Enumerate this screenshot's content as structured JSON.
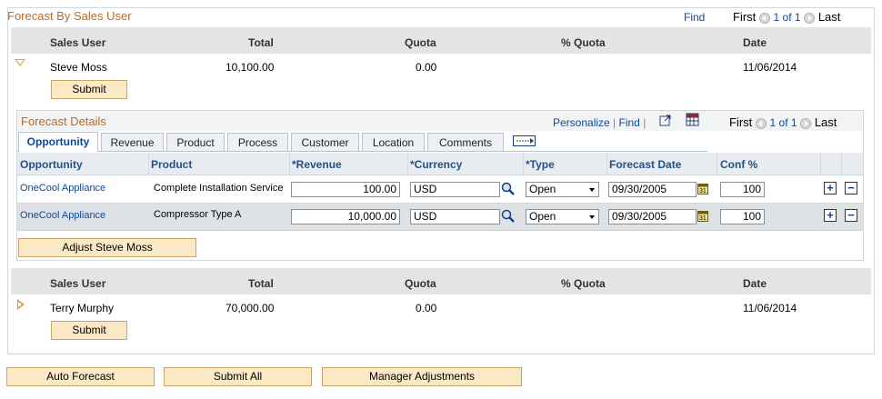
{
  "section": {
    "title": "Forecast By Sales User",
    "find": "Find",
    "first": "First",
    "count": "1 of 1",
    "last": "Last"
  },
  "user_grid": {
    "headers": [
      "Sales User",
      "Total",
      "Quota",
      "% Quota",
      "Date"
    ],
    "users": [
      {
        "name": "Steve Moss",
        "total": "10,100.00",
        "quota": "0.00",
        "pct_quota": "",
        "date": "11/06/2014",
        "submit": "Submit",
        "expanded": true
      },
      {
        "name": "Terry Murphy",
        "total": "70,000.00",
        "quota": "0.00",
        "pct_quota": "",
        "date": "11/06/2014",
        "submit": "Submit",
        "expanded": false
      }
    ]
  },
  "details": {
    "title": "Forecast Details",
    "personalize": "Personalize",
    "find": "Find",
    "first": "First",
    "count": "1 of 1",
    "last": "Last",
    "tabs": [
      "Opportunity",
      "Revenue",
      "Product",
      "Process",
      "Customer",
      "Location",
      "Comments"
    ],
    "active_tab": "Opportunity",
    "columns": [
      "Opportunity",
      "Product",
      "*Revenue",
      "*Currency",
      "*Type",
      "Forecast Date",
      "Conf %"
    ],
    "rows": [
      {
        "opportunity": "OneCool Appliance",
        "product": "Complete Installation Service",
        "revenue": "100.00",
        "currency": "USD",
        "type": "Open",
        "forecast_date": "09/30/2005",
        "conf": "100"
      },
      {
        "opportunity": "OneCool Appliance",
        "product": "Compressor Type A",
        "revenue": "10,000.00",
        "currency": "USD",
        "type": "Open",
        "forecast_date": "09/30/2005",
        "conf": "100"
      }
    ],
    "adjust_button": "Adjust Steve Moss"
  },
  "footer_buttons": {
    "auto_forecast": "Auto Forecast",
    "submit_all": "Submit All",
    "manager_adjustments": "Manager Adjustments"
  },
  "colors": {
    "section_title": "#c06a20",
    "link": "#0a4a99",
    "button_bg": "#fbe8c4"
  },
  "icons": [
    "lookup-icon",
    "calendar-icon",
    "add-row-icon",
    "delete-row-icon",
    "expand-icon",
    "collapse-icon",
    "view-all-icon",
    "download-icon",
    "show-tabs-icon"
  ]
}
